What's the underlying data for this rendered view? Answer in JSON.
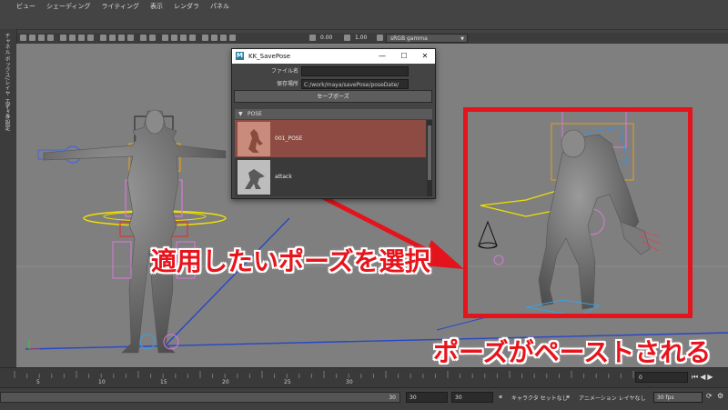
{
  "menubar": {
    "items": [
      "ビュー",
      "シェーディング",
      "ライティング",
      "表示",
      "レンダラ",
      "パネル"
    ]
  },
  "toolbar": {
    "value_a": "0.00",
    "value_b": "1.00",
    "color_space": "sRGB gamma"
  },
  "sidebar": {
    "label_1": "チャネル ボックス/レイヤ エディタ",
    "label_2": "ツール 設定"
  },
  "dialog": {
    "title": "KK_SavePose",
    "minimize": "—",
    "maximize": "☐",
    "close": "✕",
    "filename_label": "ファイル名",
    "filename_value": "",
    "savepath_label": "保存場所",
    "savepath_value": "C:/work/maya/savePose/poseDate/",
    "save_button": "セーブポーズ",
    "section_label": "POSE",
    "poses": [
      "001_POSE",
      "attack"
    ]
  },
  "annotations": {
    "select_text": "適用したいポーズを選択",
    "paste_text": "ポーズがペーストされる"
  },
  "timeline": {
    "current_frame": "0",
    "ticks": [
      "5",
      "10",
      "15",
      "20",
      "25",
      "30"
    ]
  },
  "range": {
    "start_field": "30",
    "end_field_1": "30",
    "end_field_2": "30",
    "character_set": "キャラクタ セットなし",
    "anim_layer": "アニメーション レイヤなし",
    "fps": "30 fps"
  },
  "colors": {
    "highlight": "#e4141c",
    "selected_pose": "#8e4b43",
    "viewport_bg": "#7f7f7f"
  }
}
